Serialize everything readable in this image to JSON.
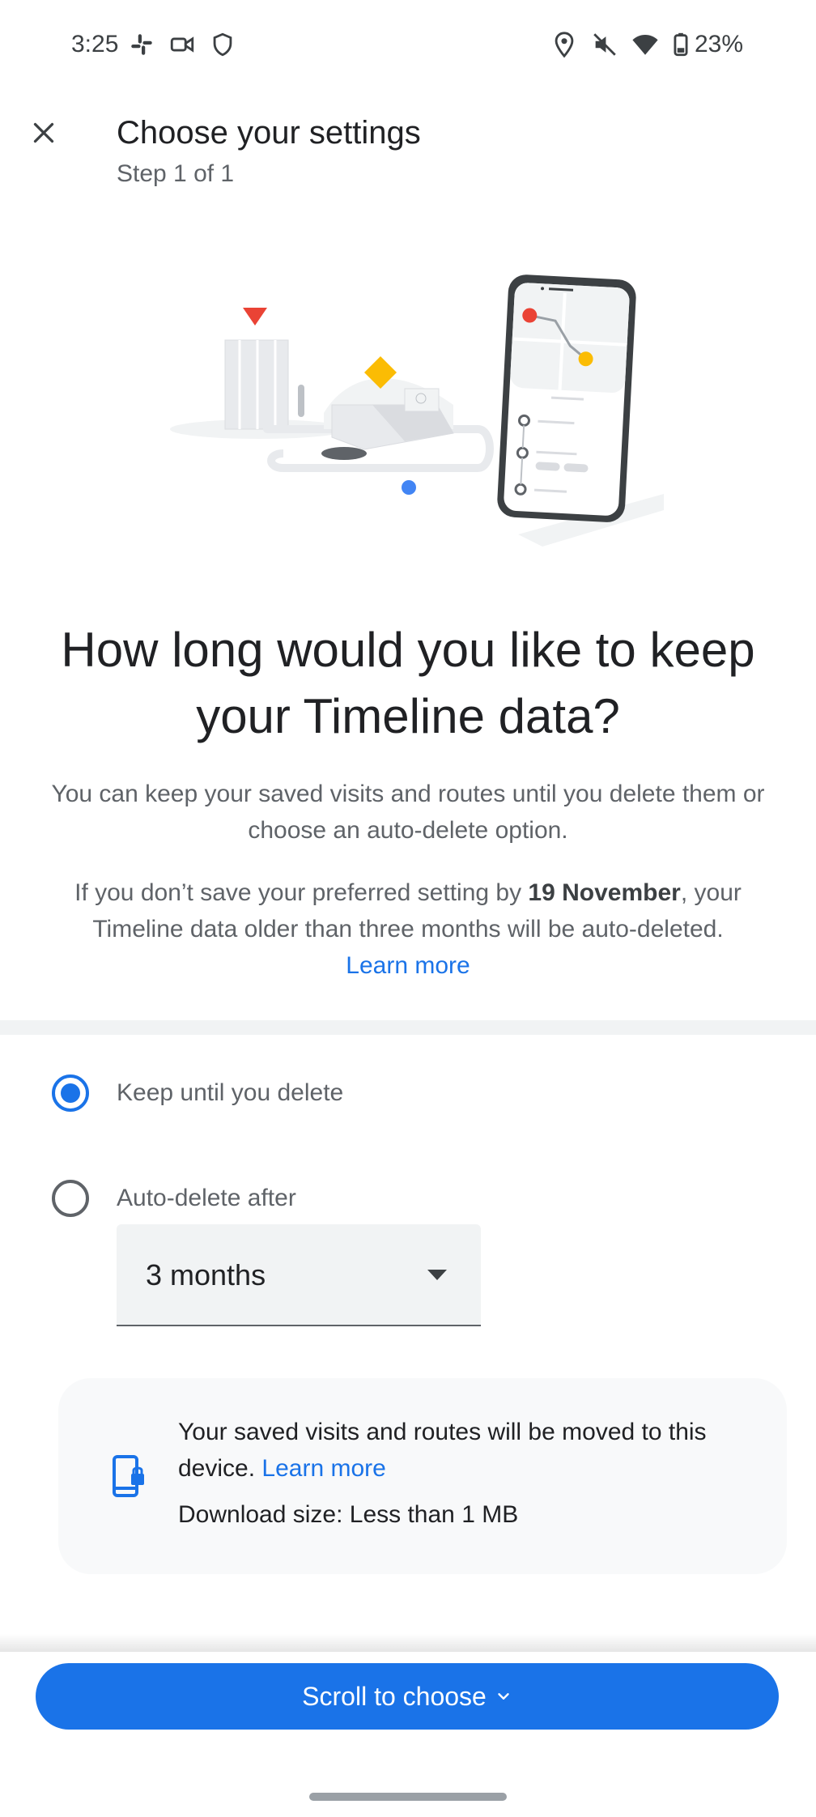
{
  "status_bar": {
    "time": "3:25",
    "battery": "23%",
    "icons": [
      "slack-icon",
      "video-camera-icon",
      "shield-icon",
      "location-icon",
      "mute-icon",
      "wifi-icon",
      "battery-icon"
    ]
  },
  "header": {
    "title": "Choose your settings",
    "subtitle": "Step 1 of 1",
    "close_icon": "close-icon"
  },
  "headline": "How long would you like to keep your Timeline data?",
  "intro": "You can keep your saved visits and routes until you delete them or choose an auto-delete option.",
  "notice": {
    "prefix": "If you don’t save your preferred setting by ",
    "date": "19 November",
    "suffix": ", your Timeline data older than three months will be auto-deleted.",
    "link": "Learn more"
  },
  "options": {
    "keep": {
      "label": "Keep until you delete",
      "selected": true
    },
    "auto_delete": {
      "label": "Auto-delete after",
      "selected": false,
      "value": "3 months"
    }
  },
  "info_card": {
    "text": "Your saved visits and routes will be moved to this device.",
    "link": "Learn more",
    "download_size": "Download size: Less than 1 MB",
    "icon": "device-lock-icon"
  },
  "cta": {
    "label": "Scroll to choose",
    "icon": "chevron-down-icon"
  },
  "colors": {
    "accent": "#1a73e8",
    "text": "#202124",
    "secondary": "#5f6368"
  }
}
